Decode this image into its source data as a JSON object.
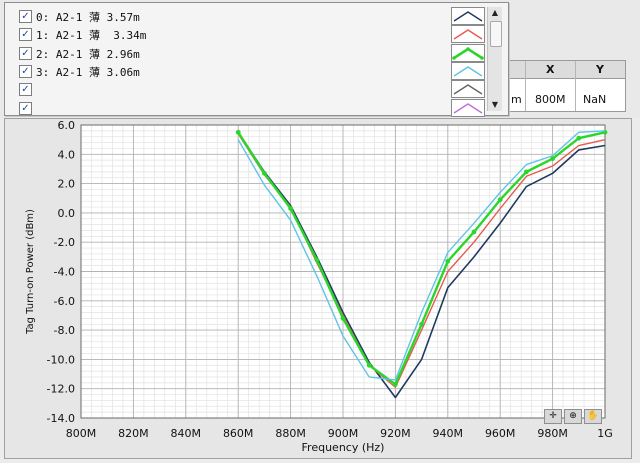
{
  "legend": {
    "items": [
      {
        "checked": true,
        "label": "0: A2-1 薄 3.57m",
        "color": "#1f3a5f",
        "bold": false
      },
      {
        "checked": true,
        "label": "1: A2-1 薄  3.34m",
        "color": "#e85a4f",
        "bold": false
      },
      {
        "checked": true,
        "label": "2: A2-1 薄 2.96m",
        "color": "#2bd62b",
        "bold": true
      },
      {
        "checked": true,
        "label": "3: A2-1 薄 3.06m",
        "color": "#5fc4e6",
        "bold": false
      },
      {
        "checked": true,
        "label": "",
        "color": "#666666",
        "bold": false
      },
      {
        "checked": true,
        "label": "",
        "color": "#c070d8",
        "bold": false
      }
    ],
    "check_glyph": "☑",
    "scroll_up_glyph": "▲",
    "scroll_down_glyph": "▼"
  },
  "cursor_table": {
    "headers": [
      "X",
      "Y"
    ],
    "row": {
      "truncated": "m",
      "x": "800M",
      "y": "NaN"
    }
  },
  "palette": {
    "icons": [
      "crosshair-icon",
      "zoom-icon",
      "pan-hand-icon"
    ],
    "glyphs": [
      "✛",
      "⊕",
      "✋"
    ]
  },
  "chart_data": {
    "type": "line",
    "xlabel": "Frequency (Hz)",
    "ylabel": "Tag Turn-on Power (dBm)",
    "xlim": [
      800,
      1000
    ],
    "ylim": [
      -14,
      6
    ],
    "x_ticks": [
      800,
      820,
      840,
      860,
      880,
      900,
      920,
      940,
      960,
      980,
      1000
    ],
    "x_tick_labels": [
      "800M",
      "820M",
      "840M",
      "860M",
      "880M",
      "900M",
      "920M",
      "940M",
      "960M",
      "980M",
      "1G"
    ],
    "y_ticks": [
      -14,
      -12,
      -10,
      -8,
      -6,
      -4,
      -2,
      0,
      2,
      4,
      6
    ],
    "y_tick_labels": [
      "-14.0",
      "-12.0",
      "-10.0",
      "-8.0",
      "-6.0",
      "-4.0",
      "-2.0",
      "0.0",
      "2.0",
      "4.0",
      "6.0"
    ],
    "grid": true,
    "x": [
      860,
      870,
      880,
      890,
      900,
      910,
      920,
      930,
      940,
      950,
      960,
      970,
      980,
      990,
      1000
    ],
    "series": [
      {
        "name": "0: A2-1 薄 3.57m",
        "color": "#1f3a5f",
        "width": 1.6,
        "markers": false,
        "values": [
          5.5,
          2.8,
          0.5,
          -3.0,
          -6.8,
          -10.2,
          -12.6,
          -10.0,
          -5.1,
          -3.0,
          -0.7,
          1.8,
          2.7,
          4.3,
          4.6
        ]
      },
      {
        "name": "1: A2-1 薄  3.34m",
        "color": "#e85a4f",
        "width": 1.4,
        "markers": false,
        "values": [
          5.4,
          2.6,
          0.4,
          -3.4,
          -7.0,
          -10.4,
          -11.9,
          -8.0,
          -4.0,
          -2.0,
          0.3,
          2.5,
          3.2,
          4.6,
          5.0
        ]
      },
      {
        "name": "2: A2-1 薄 2.96m",
        "color": "#2bd62b",
        "width": 2.4,
        "markers": true,
        "values": [
          5.5,
          2.7,
          0.3,
          -3.2,
          -7.2,
          -10.4,
          -11.7,
          -7.6,
          -3.3,
          -1.3,
          0.9,
          2.8,
          3.7,
          5.1,
          5.5
        ]
      },
      {
        "name": "3: A2-1 薄 3.06m",
        "color": "#5fc4e6",
        "width": 1.4,
        "markers": false,
        "values": [
          5.0,
          1.9,
          -0.5,
          -4.3,
          -8.4,
          -11.2,
          -11.4,
          -6.8,
          -2.7,
          -0.7,
          1.4,
          3.3,
          3.9,
          5.5,
          5.6
        ]
      }
    ]
  }
}
